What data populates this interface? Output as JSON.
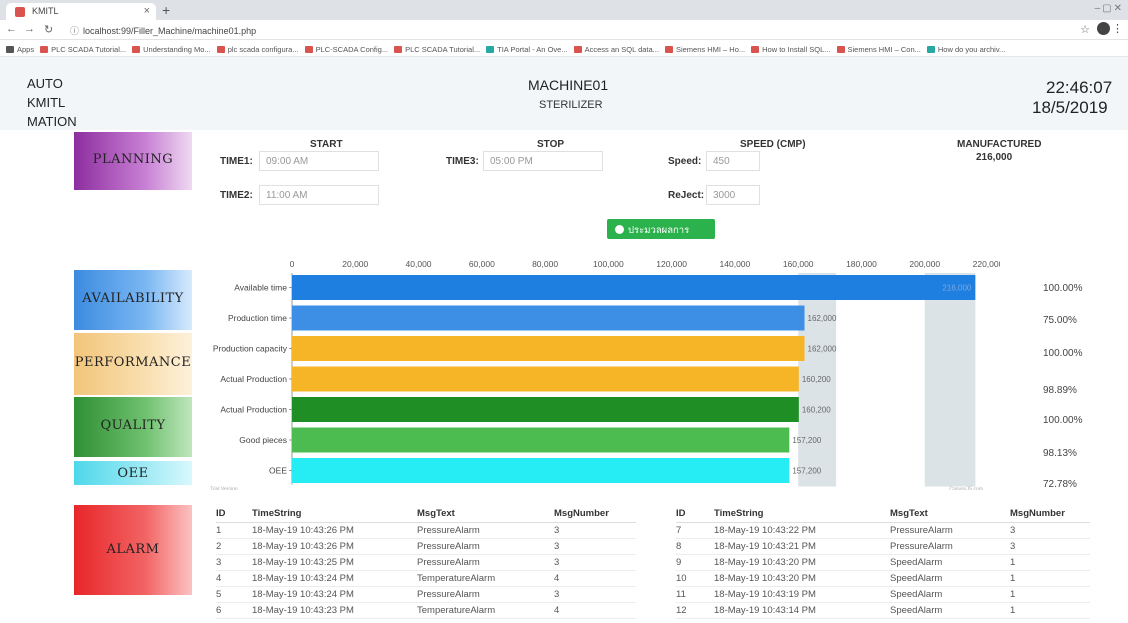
{
  "browser": {
    "tab_title": "KMITL",
    "url": "localhost:99/Filler_Machine/machine01.php",
    "bookmarks": [
      "Apps",
      "PLC SCADA Tutorial...",
      "Understanding Mo...",
      "plc scada configura...",
      "PLC-SCADA Config...",
      "PLC SCADA Tutorial...",
      "TIA Portal - An Ove...",
      "Access an SQL data...",
      "Siemens HMI – Ho...",
      "How to Install SQL...",
      "Siemens HMI – Con...",
      "How do you archiv..."
    ]
  },
  "header": {
    "brand_lines": [
      "AUTO",
      "KMITL",
      "MATION"
    ],
    "machine_name": "MACHINE01",
    "machine_type": "STERILIZER",
    "time": "22:46:07",
    "date": "18/5/2019"
  },
  "categories": {
    "planning": "PLANNING",
    "availability": "AVAILABILITY",
    "performance": "PERFORMANCE",
    "quality": "QUALITY",
    "oee": "OEE",
    "alarm": "ALARM"
  },
  "planning": {
    "start_label": "START",
    "stop_label": "STOP",
    "speed_header": "SPEED (CMP)",
    "manufactured_label": "MANUFACTURED",
    "manufactured_value": "216,000",
    "time1_label": "TIME1:",
    "time1_value": "09:00 AM",
    "time2_label": "TIME2:",
    "time2_value": "11:00 AM",
    "time3_label": "TIME3:",
    "time3_value": "05:00 PM",
    "speed_label": "Speed:",
    "speed_value": "450",
    "reject_label": "ReJect:",
    "reject_value": "3000",
    "calc_button": "ประมวลผลการทำงาน"
  },
  "chart_data": {
    "type": "bar",
    "orientation": "horizontal",
    "categories": [
      "Available time",
      "Production time",
      "Production capacity",
      "Actual Production",
      "Actual Production",
      "Good pieces",
      "OEE"
    ],
    "values": [
      216000,
      162000,
      162000,
      160200,
      160200,
      157200,
      157200
    ],
    "value_labels": [
      "216,000",
      "162,000",
      "162,000",
      "160,200",
      "160,200",
      "157,200",
      "157,200"
    ],
    "colors": [
      "#1f7fe0",
      "#3d8fe6",
      "#f6b526",
      "#f6b526",
      "#1e8e25",
      "#4cbc50",
      "#25edf3"
    ],
    "percentages": [
      "100.00%",
      "75.00%",
      "100.00%",
      "98.89%",
      "100.00%",
      "98.13%",
      "72.78%"
    ],
    "xticks": [
      "0",
      "20,000",
      "40,000",
      "60,000",
      "80,000",
      "100,000",
      "120,000",
      "140,000",
      "160,000",
      "180,000",
      "200,000",
      "220,000"
    ],
    "xlim": [
      0,
      220000
    ],
    "grid": false,
    "trial_label": "Trial Version",
    "credit_label": "CanvasJS.com"
  },
  "alarms": {
    "columns": [
      "ID",
      "TimeString",
      "MsgText",
      "MsgNumber"
    ],
    "left": [
      [
        "1",
        "18-May-19 10:43:26 PM",
        "PressureAlarm",
        "3"
      ],
      [
        "2",
        "18-May-19 10:43:26 PM",
        "PressureAlarm",
        "3"
      ],
      [
        "3",
        "18-May-19 10:43:25 PM",
        "PressureAlarm",
        "3"
      ],
      [
        "4",
        "18-May-19 10:43:24 PM",
        "TemperatureAlarm",
        "4"
      ],
      [
        "5",
        "18-May-19 10:43:24 PM",
        "PressureAlarm",
        "3"
      ],
      [
        "6",
        "18-May-19 10:43:23 PM",
        "TemperatureAlarm",
        "4"
      ]
    ],
    "right": [
      [
        "7",
        "18-May-19 10:43:22 PM",
        "PressureAlarm",
        "3"
      ],
      [
        "8",
        "18-May-19 10:43:21 PM",
        "PressureAlarm",
        "3"
      ],
      [
        "9",
        "18-May-19 10:43:20 PM",
        "SpeedAlarm",
        "1"
      ],
      [
        "10",
        "18-May-19 10:43:20 PM",
        "SpeedAlarm",
        "1"
      ],
      [
        "11",
        "18-May-19 10:43:19 PM",
        "SpeedAlarm",
        "1"
      ],
      [
        "12",
        "18-May-19 10:43:14 PM",
        "SpeedAlarm",
        "1"
      ]
    ]
  }
}
